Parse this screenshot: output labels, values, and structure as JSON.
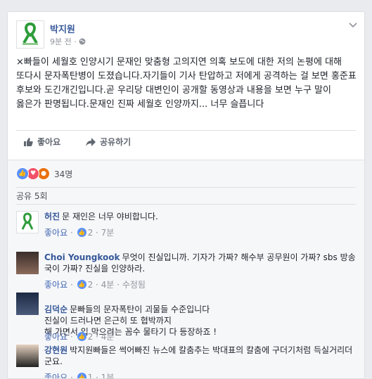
{
  "post": {
    "page_name": "박지원",
    "time": "9분 전",
    "separator": "·",
    "privacy_icon": "globe-icon",
    "text": "×빠들이 세월호 인양시기 문재인 맞춤형 고의지연 의혹 보도에 대한 저의 논평에 대해 또다시 문자폭탄병이 도졌습니다.자기들이 기사 탄압하고 저에게 공격하는 걸 보면 홍준표 후보와 도긴개긴입니다.곧 우리당 대변인이 공개할 동영상과 내용을 보면 누구 말이 옳은가 판명됩니다.문재인 진짜 세월호 인양까지... 너무 슬픕니다"
  },
  "actions": {
    "like": "좋아요",
    "share": "공유하기"
  },
  "reactions": {
    "count": "34명"
  },
  "shares": {
    "label": "공유 5회"
  },
  "comments": [
    {
      "author": "허진",
      "text": "문 재인은 너무 야비합니다.",
      "like": "좋아요",
      "likes": "2",
      "time": "7분",
      "edited": ""
    },
    {
      "author": "Choi Youngkook",
      "text": "무엇이 진실입니까. 기자가 가짜? 해수부 공무원이 가짜? sbs 방송국이 가짜? 진실을 인양하라.",
      "like": "좋아요",
      "likes": "2",
      "time": "4분",
      "edited": "수정됨"
    },
    {
      "author": "김덕순",
      "text": "문빠들의 문자폭탄이 괴물들 수준입니다\n진실이 드러나면 은근히 또 협박까지\n해 가면서 입 막으려는 꼼수 물타기 다 등장하죠 !",
      "like": "좋아요",
      "likes": "2",
      "time": "4분",
      "edited": ""
    },
    {
      "author": "강현원",
      "text": "박지원빠들은 썩어빠진 뉴스에 칼춤추는 박대표의 칼춤에 구더기처럼 득실거리더군요.",
      "like": "좋아요",
      "likes": "1",
      "time": "1분",
      "edited": ""
    }
  ],
  "colors": {
    "link": "#365899",
    "brand": "#4267b2",
    "ribbon": "#2e9c3a"
  }
}
